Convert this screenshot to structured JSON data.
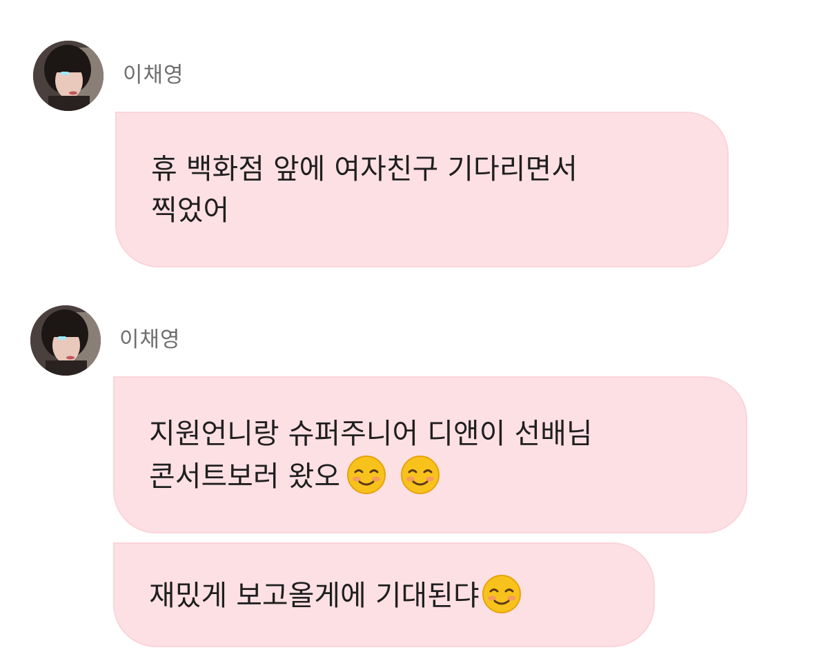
{
  "messages": [
    {
      "sender": "이채영",
      "avatar_icon": "profile-photo",
      "bubbles": [
        {
          "lines": [
            "휴 백화점 앞에 여자친구 기다리면서",
            "찍었어"
          ]
        }
      ]
    },
    {
      "sender": "이채영",
      "avatar_icon": "profile-photo",
      "bubbles": [
        {
          "lines": [
            "지원언니랑 슈퍼주니어 디앤이 선배님",
            "콘서트보러 왔오"
          ],
          "emoji": "smiling-face-icon"
        },
        {
          "lines": [
            "재밌게 보고올게에 기대된댜"
          ],
          "emoji": "smiling-face-icon"
        }
      ]
    }
  ],
  "colors": {
    "bubble_bg": "#fde0e4",
    "bubble_border": "#fbd4da",
    "sender_text": "#6e6e6e",
    "message_text": "#1f1f1f"
  }
}
